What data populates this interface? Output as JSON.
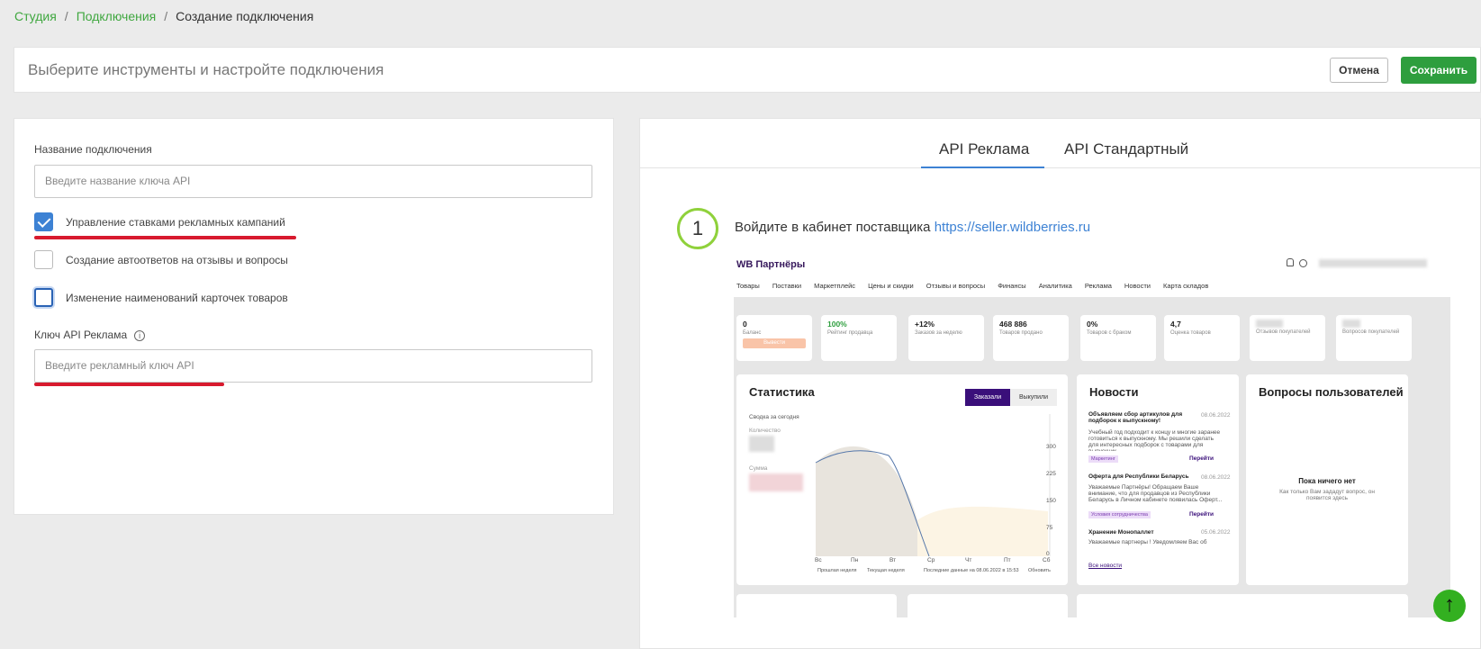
{
  "breadcrumb": {
    "items": [
      "Студия",
      "Подключения",
      "Создание подключения"
    ],
    "separator": "/"
  },
  "header": {
    "title": "Выберите инструменты и настройте подключения",
    "cancel_label": "Отмена",
    "save_label": "Сохранить"
  },
  "form": {
    "name_label": "Название подключения",
    "name_placeholder": "Введите название ключа API",
    "checkboxes": [
      {
        "label": "Управление ставками рекламных кампаний",
        "checked": true
      },
      {
        "label": "Создание автоответов на отзывы и вопросы",
        "checked": false
      },
      {
        "label": "Изменение наименований карточек товаров",
        "checked": false
      }
    ],
    "api_key_label": "Ключ API Реклама",
    "api_key_placeholder": "Введите рекламный ключ API"
  },
  "instructions": {
    "tabs": [
      {
        "label": "API Реклама",
        "active": true
      },
      {
        "label": "API Стандартный",
        "active": false
      }
    ],
    "step": {
      "number": "1",
      "text": "Войдите в кабинет поставщика ",
      "link": "https://seller.wildberries.ru"
    }
  },
  "seller_screenshot": {
    "brand": "WB Партнёры",
    "nav": [
      "Товары",
      "Поставки",
      "Маркетплейс",
      "Цены и скидки",
      "Отзывы и вопросы",
      "Финансы",
      "Аналитика",
      "Реклама",
      "Новости",
      "Карта складов"
    ],
    "kpis": [
      {
        "value": "0",
        "label": "Баланс",
        "button": "Вывести"
      },
      {
        "value": "100%",
        "label": "Рейтинг продавца"
      },
      {
        "value": "+12%",
        "label": "Заказов за неделю"
      },
      {
        "value": "468 886",
        "label": "Товаров продано"
      },
      {
        "value": "0%",
        "label": "Товаров с браком"
      },
      {
        "value": "4,7",
        "label": "Оценка товаров"
      },
      {
        "value": "",
        "label": "Отзывов покупателей"
      },
      {
        "value": "",
        "label": "Вопросов покупателей"
      }
    ],
    "stats": {
      "title": "Статистика",
      "tab_orders": "Заказали",
      "tab_bought": "Выкупили",
      "today": "Сводка за сегодня",
      "qty": "Количество",
      "sum": "Сумма",
      "y_ticks": [
        "300",
        "225",
        "150",
        "75",
        "0"
      ],
      "days": [
        "Вс",
        "Пн",
        "Вт",
        "Ср",
        "Чт",
        "Пт",
        "Сб"
      ],
      "legend_prev": "Прошлая неделя",
      "legend_cur": "Текущая неделя",
      "updated": "Последние данные на 08.06.2022 в 15:53",
      "refresh": "Обновить"
    },
    "news": {
      "title": "Новости",
      "items": [
        {
          "title": "Объявляем сбор артикулов для подборок к выпускному!",
          "date": "08.06.2022",
          "text": "Учебный год подходит к концу и многие заранее готовиться к выпускному. Мы решили сделать для интересных подборок с товарами для выпускник",
          "tag": "Маркетинг",
          "link": "Перейти"
        },
        {
          "title": "Оферта для Республики Беларусь",
          "date": "08.06.2022",
          "text": "Уважаемые Партнёры! Обращаем Ваше внимание, что для продавцов из Республики Беларусь в Личном кабинете появилась Оферт...",
          "tag": "Условия сотрудничества",
          "link": "Перейти"
        },
        {
          "title": "Хранение Монопаллет",
          "date": "05.06.2022",
          "text": "Уважаемые партнеры ! Уведомляем Вас об"
        }
      ],
      "all": "Все новости"
    },
    "questions": {
      "title": "Вопросы пользователей",
      "empty": "Пока ничего нет",
      "empty_sub": "Как только Вам зададут вопрос, он появится здесь"
    }
  }
}
